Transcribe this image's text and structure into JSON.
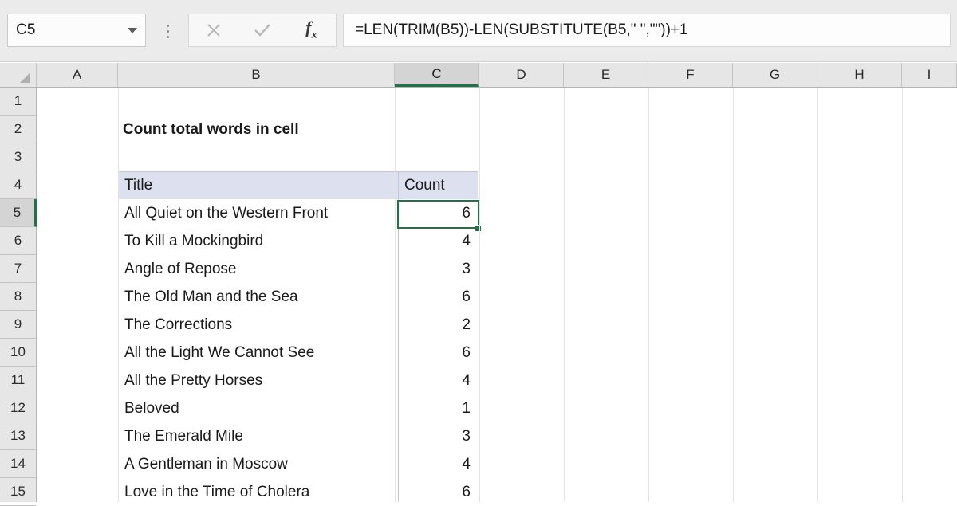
{
  "formula_bar": {
    "name_box_value": "C5",
    "formula": "=LEN(TRIM(B5))-LEN(SUBSTITUTE(B5,\" \",\"\"))+1",
    "cancel_icon": "close-icon",
    "confirm_icon": "check-icon",
    "function_icon": "fx-icon",
    "dropdown_icon": "chevron-down-icon",
    "more_icon": "kebab-menu-icon"
  },
  "grid": {
    "columns": [
      "A",
      "B",
      "C",
      "D",
      "E",
      "F",
      "G",
      "H",
      "I"
    ],
    "selected_column": "C",
    "rows": [
      "1",
      "2",
      "3",
      "4",
      "5",
      "6",
      "7",
      "8",
      "9",
      "10",
      "11",
      "12",
      "13",
      "14",
      "15"
    ],
    "selected_row": "5",
    "selected_cell": "C5"
  },
  "sheet": {
    "title": "Count total words in cell",
    "table": {
      "headers": [
        "Title",
        "Count"
      ],
      "rows": [
        {
          "title": "All Quiet on the Western Front",
          "count": "6"
        },
        {
          "title": "To Kill a Mockingbird",
          "count": "4"
        },
        {
          "title": "Angle of Repose",
          "count": "3"
        },
        {
          "title": "The Old Man and the Sea",
          "count": "6"
        },
        {
          "title": "The Corrections",
          "count": "2"
        },
        {
          "title": "All the Light We Cannot See",
          "count": "6"
        },
        {
          "title": "All the Pretty Horses",
          "count": "4"
        },
        {
          "title": "Beloved",
          "count": "1"
        },
        {
          "title": "The Emerald Mile",
          "count": "3"
        },
        {
          "title": "A Gentleman in Moscow",
          "count": "4"
        },
        {
          "title": "Love in the Time of Cholera",
          "count": "6"
        }
      ]
    }
  },
  "colors": {
    "selection_green": "#217346",
    "table_header_fill": "#dce0ef",
    "toolbar_gray": "#ebebeb",
    "header_strip_gray": "#e6e6e6"
  }
}
